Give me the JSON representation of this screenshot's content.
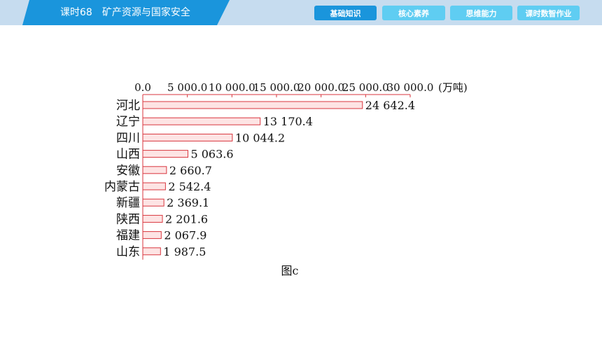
{
  "header": {
    "lesson_number": "课时68",
    "lesson_title": "矿产资源与国家安全"
  },
  "nav": {
    "items": [
      {
        "label": "基础知识",
        "active": true
      },
      {
        "label": "核心素养",
        "active": false
      },
      {
        "label": "思维能力",
        "active": false
      },
      {
        "label": "课时数智作业",
        "active": false
      }
    ]
  },
  "colors": {
    "header_blue": "#1a95dc",
    "nav_active": "#1a95dc",
    "nav_inactive": "#5fcdf2",
    "bar_fill": "#fde4e4",
    "bar_stroke": "#d9363e"
  },
  "chart_data": {
    "type": "bar",
    "orientation": "horizontal",
    "axis_position": "top",
    "xlim": [
      0,
      30000
    ],
    "x_tick_labels": [
      "0.0",
      "5 000.0",
      "10 000.0",
      "15 000.0",
      "20 000.0",
      "25 000.0",
      "30 000.0"
    ],
    "x_unit": "(万吨)",
    "categories": [
      "河北",
      "辽宁",
      "四川",
      "山西",
      "安徽",
      "内蒙古",
      "新疆",
      "陕西",
      "福建",
      "山东"
    ],
    "values": [
      24642.4,
      13170.4,
      10044.2,
      5063.6,
      2660.7,
      2542.4,
      2369.1,
      2201.6,
      2067.9,
      1987.5
    ],
    "value_labels": [
      "24 642.4",
      "13 170.4",
      "10 044.2",
      "5 063.6",
      "2 660.7",
      "2 542.4",
      "2 369.1",
      "2 201.6",
      "2 067.9",
      "1 987.5"
    ],
    "caption": "图c"
  }
}
